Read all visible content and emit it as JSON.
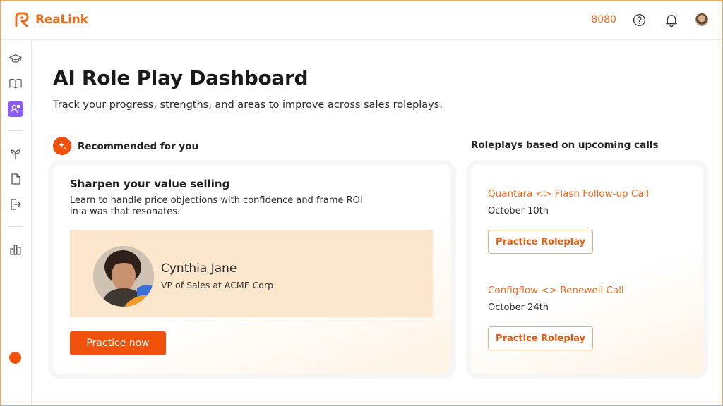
{
  "header": {
    "logo_text": "ReaLink",
    "port": "8080",
    "icons": [
      "help-circle-icon",
      "bell-icon",
      "user-avatar"
    ]
  },
  "sidebar": {
    "items": [
      {
        "icon": "graduation-cap-icon"
      },
      {
        "icon": "open-book-icon"
      },
      {
        "icon": "roleplay-people-icon",
        "active": true
      },
      {
        "icon": "sprout-icon"
      },
      {
        "icon": "document-icon"
      },
      {
        "icon": "export-icon"
      },
      {
        "icon": "bar-chart-icon"
      }
    ]
  },
  "main": {
    "title": "AI Role Play Dashboard",
    "subtitle": "Track your progress, strengths, and areas to improve across sales roleplays.",
    "recommended": {
      "heading": "Recommended for you",
      "card_title": "Sharpen your value selling",
      "card_desc": "Learn to handle price objections with confidence and frame ROI in a was that resonates.",
      "persona_name": "Cynthia Jane",
      "persona_role": "VP of Sales at ACME Corp",
      "button": "Practice now"
    },
    "upcoming": {
      "heading": "Roleplays based on upcoming calls",
      "calls": [
        {
          "title": "Quantara <> Flash Follow-up Call",
          "date": "October 10th",
          "button": "Practice Roleplay"
        },
        {
          "title": "Configflow <> Renewell Call",
          "date": "October 24th",
          "button": "Practice Roleplay"
        }
      ]
    }
  },
  "colors": {
    "accent": "#f2510c",
    "accent_text": "#f26b1d",
    "persona_bg": "#fde7cc",
    "active_nav": "#8b5cf6"
  }
}
